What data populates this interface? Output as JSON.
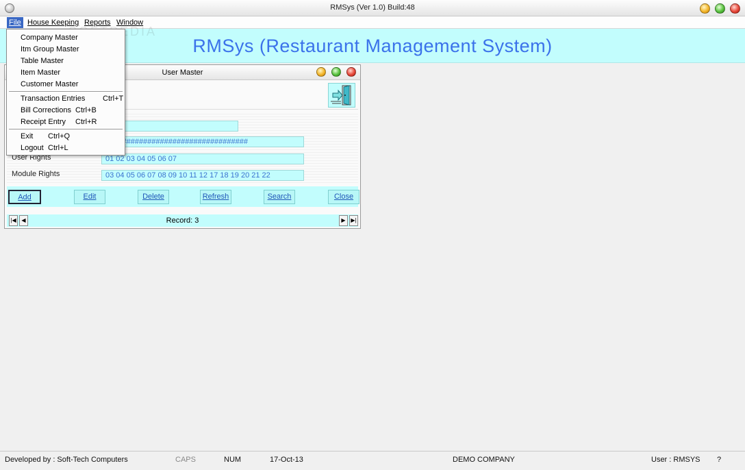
{
  "window": {
    "title": "RMSys (Ver 1.0) Build:48"
  },
  "menubar": {
    "file": "File",
    "housekeeping": "House Keeping",
    "reports": "Reports",
    "window": "Window"
  },
  "banner": {
    "title": "RMSys (Restaurant Management System)"
  },
  "file_menu": {
    "items": [
      {
        "label": "Company Master",
        "shortcut": ""
      },
      {
        "label": "Itm Group Master",
        "shortcut": ""
      },
      {
        "label": "Table Master",
        "shortcut": ""
      },
      {
        "label": "Item Master",
        "shortcut": ""
      },
      {
        "label": "Customer Master",
        "shortcut": ""
      },
      {
        "label": "Transaction Entries",
        "shortcut": "Ctrl+T"
      },
      {
        "label": "Bill Corrections",
        "shortcut": "Ctrl+B"
      },
      {
        "label": "Receipt Entry",
        "shortcut": "Ctrl+R"
      },
      {
        "label": "Exit",
        "shortcut": "Ctrl+Q"
      },
      {
        "label": "Logout",
        "shortcut": "Ctrl+L"
      }
    ]
  },
  "user_master": {
    "title": "User Master",
    "fields": {
      "field1_value": "",
      "password_value": "##################################",
      "user_rights_label": "User Rights",
      "user_rights_value": "01 02 03 04 05 06 07",
      "module_rights_label": "Module Rights",
      "module_rights_value": "03 04 05 06 07 08 09 10 11 12 17 18 19 20 21 22"
    },
    "buttons": {
      "add": "Add",
      "edit": "Edit",
      "delete": "Delete",
      "refresh": "Refresh",
      "search": "Search",
      "close": "Close"
    },
    "record": "Record: 3"
  },
  "statusbar": {
    "developer": "Developed by : Soft-Tech Computers",
    "caps": "CAPS",
    "num": "NUM",
    "date": "17-Oct-13",
    "company": "DEMO COMPANY",
    "user": "User : RMSYS",
    "help": "?"
  },
  "colors": {
    "banner_bg": "#c2fdfd",
    "banner_text": "#3b72ea",
    "menu_highlight": "#3a68c4",
    "field_text": "#3a72d0"
  }
}
